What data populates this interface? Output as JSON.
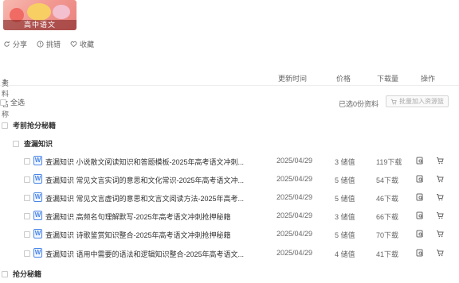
{
  "cover": {
    "caption": "高中语文"
  },
  "actions": [
    {
      "label": "分享",
      "icon": "share-icon"
    },
    {
      "label": "挑错",
      "icon": "report-icon"
    },
    {
      "label": "收藏",
      "icon": "heart-icon"
    }
  ],
  "table": {
    "headers": {
      "name": "资料名称",
      "updated": "更新时间",
      "price": "价格",
      "downloads": "下载量",
      "ops": "操作"
    },
    "select_all": "全选",
    "selected_count": "已选0份资料",
    "batch_cart": "批量加入资源篮"
  },
  "groups": {
    "top": "考前抢分秘籍",
    "sub": "查漏知识",
    "next": "抢分秘籍"
  },
  "rows": [
    {
      "title": "查漏知识 小说散文阅读知识和答题模板-2025年高考语文冲刺...",
      "date": "2025/04/29",
      "price": "3 储值",
      "downloads": "119下载"
    },
    {
      "title": "查漏知识 常见文言实词的意思和文化常识-2025年高考语文冲...",
      "date": "2025/04/29",
      "price": "5 储值",
      "downloads": "54下载"
    },
    {
      "title": "查漏知识 常见文言虚词的意思和文言文阅读方法-2025年高考...",
      "date": "2025/04/29",
      "price": "5 储值",
      "downloads": "46下载"
    },
    {
      "title": "查漏知识 高频名句理解默写-2025年高考语文冲刺抢押秘籍",
      "date": "2025/04/29",
      "price": "3 储值",
      "downloads": "66下载"
    },
    {
      "title": "查漏知识 诗歌鉴赏知识整合-2025年高考语文冲刺抢押秘籍",
      "date": "2025/04/29",
      "price": "5 储值",
      "downloads": "70下载"
    },
    {
      "title": "查漏知识 语用中需要的语法和逻辑知识整合-2025年高考语文...",
      "date": "2025/04/29",
      "price": "4 储值",
      "downloads": "41下载"
    }
  ]
}
